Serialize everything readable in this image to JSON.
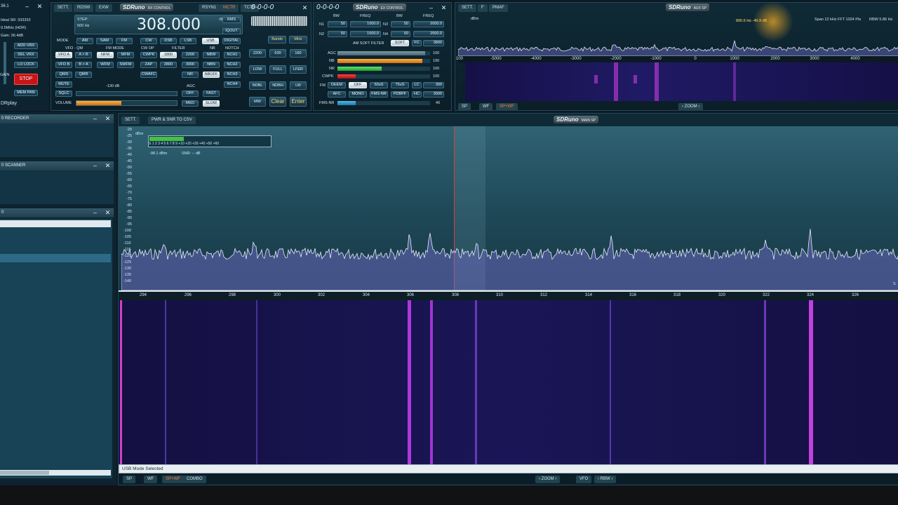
{
  "left_panel": {
    "window_num": "36.1",
    "info": [
      "Ideal SR: 333333",
      "0.5MHz (HDR)",
      "Gain: 36.4dB"
    ],
    "buttons": [
      "ADD VRX",
      "DEL VRX",
      "LO LOCK"
    ],
    "gain_label": "GAIN",
    "stop": "STOP",
    "mem_pan": "MEM PAN",
    "drplay": "DRplay"
  },
  "rx_control": {
    "tabs": [
      "SETT.",
      "RDSW",
      "EXW"
    ],
    "brand": "SDRuno",
    "brand_sub": "RX CONTROL",
    "right_tabs": [
      "RSYN1",
      "MCTR",
      "TCTR"
    ],
    "step_label": "STEP:",
    "step_value": "500 Hz",
    "frequency": "308.000",
    "level": "-98.1 dBm",
    "mode_label": "MODE",
    "modes": [
      "AM",
      "SAM",
      "FM",
      "CW",
      "DSB",
      "LSB",
      "USB",
      "DIGITAL"
    ],
    "vfo_label": "VFO - QM",
    "fm_mode_label": "FM MODE",
    "cw_op_label": "CW OP",
    "filter_label": "FILTER",
    "nb_label": "NB",
    "notch_label": "NOTCH",
    "row1": [
      "VFO A",
      "A > B",
      "NFM",
      "MFM",
      "CWPK",
      "1800",
      "2200",
      "NBW",
      "NCH1"
    ],
    "row2": [
      "VFO B",
      "B > A",
      "WFM",
      "SWFM",
      "ZAP",
      "2800",
      "3000",
      "NBN",
      "NCH2"
    ],
    "row3": [
      "QMS",
      "QMR",
      "CWAFC",
      "NR",
      "NBOFF",
      "NCH3"
    ],
    "mute": "MUTE",
    "sqlc": "SQLC",
    "sql_level": "-130 dB",
    "agc_label": "AGC",
    "agc": [
      "OFF",
      "FAST",
      "MED",
      "SLOW"
    ],
    "volume": "VOLUME",
    "side_buttons": [
      "RMS",
      "IQOUT"
    ],
    "notch4": "NCH4",
    "volume_level": 0.45
  },
  "keypad": {
    "mini_freq": "0-0-0-0",
    "bands": "Bands",
    "mhz": "MHz",
    "row1": [
      "2200",
      "630",
      "160"
    ],
    "row2": [
      "LOW",
      "FULL",
      "LFER"
    ],
    "row3": [
      "NDBL",
      "NDBH",
      "LW"
    ],
    "row4": [
      "MW",
      "Clear",
      "Enter"
    ]
  },
  "ex_control": {
    "mini_freq": "0-0-0-0",
    "brand": "SDRuno",
    "brand_sub": "EX CONTROL",
    "bw_label": "BW",
    "freq_label": "FREQ",
    "n1": "N1",
    "n2": "N2",
    "n3": "N3",
    "n4": "N4",
    "n1_bw": "50",
    "n1_freq": "1000.0",
    "n2_bw": "50",
    "n2_freq": "1500.0",
    "n3_bw": "50",
    "n3_freq": "2000.0",
    "n4_bw": "50",
    "n4_freq": "2500.0",
    "am_soft": "AM SOFT FILTER",
    "soft": "SOFT",
    "fc": "FC",
    "fc_value": "3800",
    "agc": "AGC",
    "nb": "NB",
    "nr": "NR",
    "cwpk": "CWPK",
    "agc_val": "100",
    "nb_val": "190",
    "nr_val": "100",
    "cwpk_val": "100",
    "fm_label": "FM",
    "fm_row1": [
      "DEEM",
      "OFF",
      "50uS",
      "75uS",
      "LC",
      "300"
    ],
    "fm_row2": [
      "AFC",
      "MONO",
      "FMS-NR",
      "PDBPF",
      "HC",
      "3000"
    ],
    "fmsnr": "FMS-NR",
    "fmsnr_val": "40",
    "agc_level": 0.95,
    "nb_level": 0.92,
    "nr_level": 0.48,
    "cwpk_level": 0.2,
    "fmsnr_level": 0.2
  },
  "aux_sp": {
    "tabs": [
      "SETT.",
      "F",
      "PMAF"
    ],
    "brand": "SDRuno",
    "brand_sub": "AUX SP",
    "dbm": "dBm",
    "marker": "890.6 Hz -49.9 dB",
    "span": "Span 12 kHz",
    "fft": "FFT 1024 Pts",
    "rbw": "RBW 5.86 Hz",
    "ticks": [
      "100",
      "-5000",
      "-4000",
      "-3000",
      "-2000",
      "-1000",
      "0",
      "1000",
      "2000",
      "3000",
      "4000"
    ],
    "bottom_tabs": [
      "SP",
      "WF",
      "SP+WF"
    ],
    "zoom": "ZOOM"
  },
  "recorder": {
    "title": "RECORDER",
    "num": "0"
  },
  "scanner": {
    "title": "SCANNER",
    "num": "0"
  },
  "memory": {
    "num": "0"
  },
  "main_sp": {
    "tabs": [
      "SETT.",
      "PWR & SNR TO CSV"
    ],
    "brand": "SDRuno",
    "brand_sub": "MAIN SP",
    "dbm": "dBm",
    "smeter_scale": "S  1  2  3  4  5  6  7  8  9  +10 +20 +30 +40 +50 +60",
    "level": "-98.1 dBm",
    "snr": "SNR: -- dB",
    "smeter_level": 0.28,
    "y_ticks": [
      "-20",
      "-25",
      "-30",
      "-35",
      "-40",
      "-45",
      "-50",
      "-55",
      "-60",
      "-65",
      "-70",
      "-75",
      "-80",
      "-85",
      "-90",
      "-95",
      "-100",
      "-105",
      "-110",
      "-115",
      "-120",
      "-125",
      "-130",
      "-135",
      "-140"
    ],
    "x_ticks": [
      "294",
      "296",
      "298",
      "300",
      "302",
      "304",
      "306",
      "308",
      "310",
      "312",
      "314",
      "316",
      "318",
      "320",
      "322",
      "324",
      "326"
    ],
    "status": "USB Mode Selected",
    "bottom_tabs": [
      "SP",
      "WF",
      "SP+WF",
      "COMBO"
    ],
    "zoom": "ZOOM",
    "vfo": "VFO",
    "rbw": "RBW",
    "s_label": "S"
  },
  "colors": {
    "accent": "#f0a020",
    "stop": "#d21414",
    "waterfall": "#12103a",
    "signal": "#c040e0"
  }
}
